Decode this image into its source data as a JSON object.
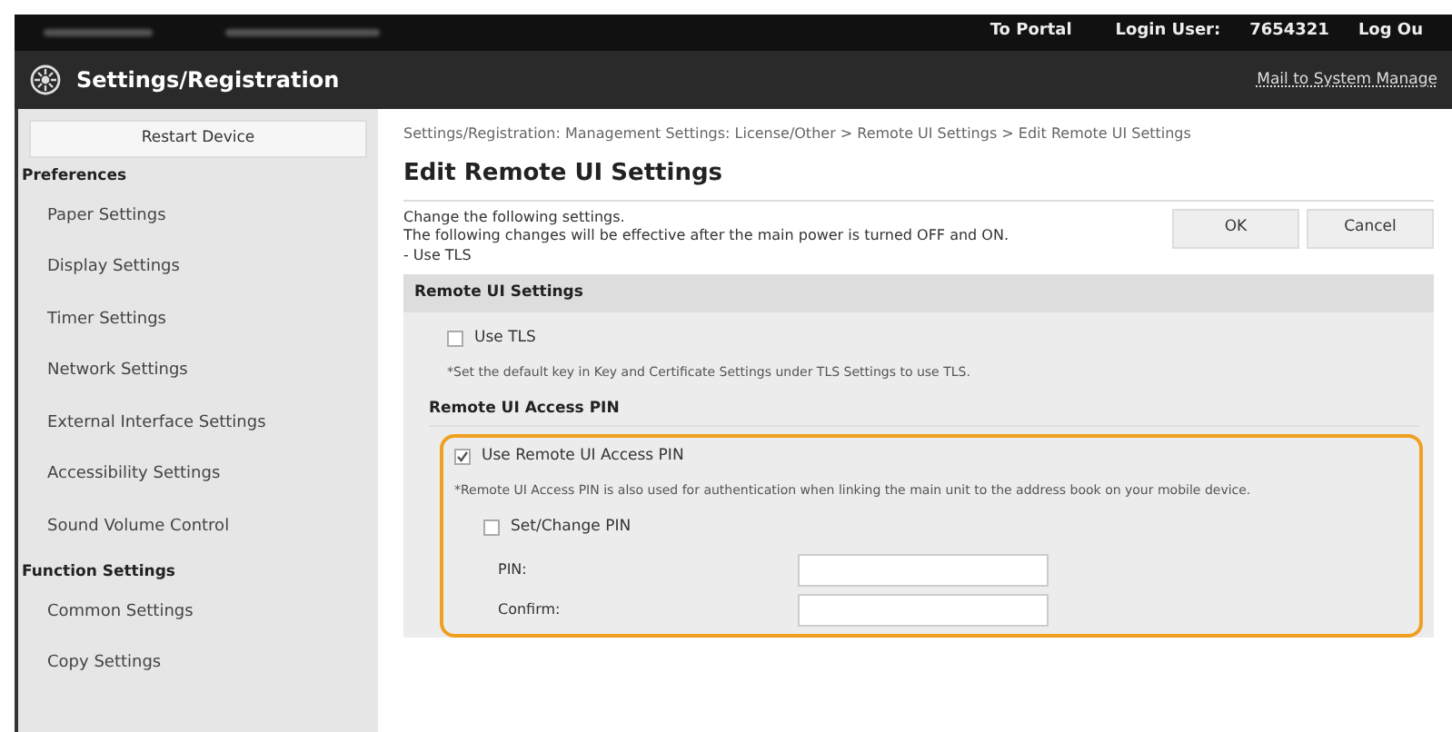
{
  "top_bar": {
    "links": [
      "To Portal"
    ],
    "login_label": "Login User:",
    "login_user": "7654321",
    "logout": "Log Ou"
  },
  "header": {
    "title": "Settings/Registration",
    "mail_link": "Mail to System Manage"
  },
  "sidebar": {
    "restart_button": "Restart Device",
    "groups": [
      {
        "title": "Preferences",
        "items": [
          {
            "label": "Paper Settings"
          },
          {
            "label": "Display Settings"
          },
          {
            "label": "Timer Settings"
          },
          {
            "label": "Network Settings"
          },
          {
            "label": "External Interface Settings"
          },
          {
            "label": "Accessibility Settings"
          },
          {
            "label": "Sound Volume Control"
          }
        ]
      },
      {
        "title": "Function Settings",
        "items": [
          {
            "label": "Common Settings"
          },
          {
            "label": "Copy Settings"
          }
        ]
      }
    ]
  },
  "breadcrumb": "Settings/Registration: Management Settings: License/Other > Remote UI Settings > Edit Remote UI Settings",
  "page_title": "Edit Remote UI Settings",
  "intro": [
    "Change the following settings.",
    "The following changes will be effective after the main power is turned OFF and ON.",
    "- Use TLS"
  ],
  "buttons": [
    "OK",
    "Cancel"
  ],
  "section": {
    "title": "Remote UI Settings",
    "use_tls": {
      "label": "Use TLS",
      "checked": false
    },
    "tls_note": "*Set the default key in Key and Certificate Settings under TLS Settings to use TLS.",
    "pin_title": "Remote UI Access PIN",
    "use_pin": {
      "label": "Use Remote UI Access PIN",
      "checked": true
    },
    "pin_note": "*Remote UI Access PIN is also used for authentication when linking the main unit to the address book on your mobile device.",
    "set_pin": {
      "label": "Set/Change PIN",
      "checked": false
    },
    "fields": [
      {
        "label": "PIN:"
      },
      {
        "label": "Confirm:"
      }
    ]
  }
}
